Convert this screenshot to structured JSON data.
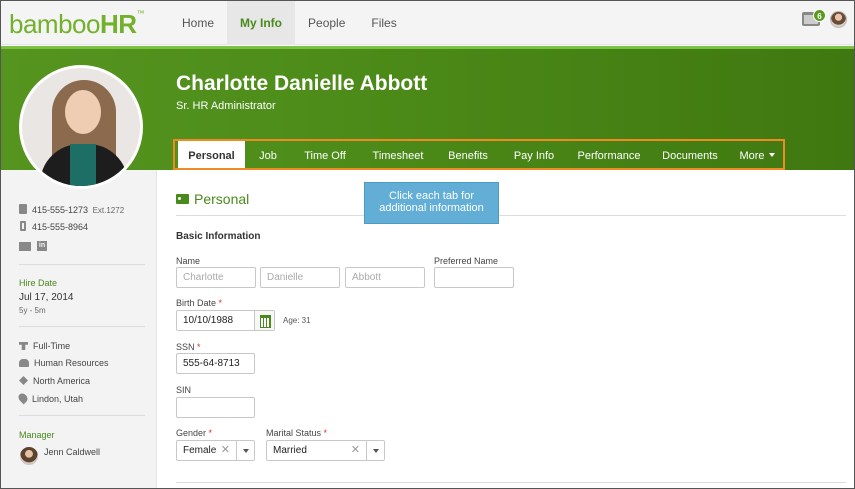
{
  "app": {
    "logo_main": "bamboo",
    "logo_bold": "HR",
    "logo_tm": "™"
  },
  "nav": {
    "items": [
      {
        "label": "Home"
      },
      {
        "label": "My Info"
      },
      {
        "label": "People"
      },
      {
        "label": "Files"
      }
    ],
    "active": "My Info",
    "inbox_count": "6"
  },
  "employee": {
    "name": "Charlotte Danielle Abbott",
    "title": "Sr. HR Administrator"
  },
  "tabs": {
    "items": [
      {
        "label": "Personal"
      },
      {
        "label": "Job"
      },
      {
        "label": "Time Off"
      },
      {
        "label": "Timesheet"
      },
      {
        "label": "Benefits"
      },
      {
        "label": "Pay Info"
      },
      {
        "label": "Performance"
      },
      {
        "label": "Documents"
      },
      {
        "label": "More"
      }
    ],
    "active": "Personal"
  },
  "sidebar": {
    "work_phone": "415-555-1273",
    "work_ext": "Ext.1272",
    "mobile_phone": "415-555-8964",
    "hire_date_label": "Hire Date",
    "hire_date": "Jul 17, 2014",
    "tenure": "5y - 5m",
    "employment_type": "Full-Time",
    "department": "Human Resources",
    "region": "North America",
    "location": "Lindon, Utah",
    "manager_label": "Manager",
    "manager_name": "Jenn Caldwell"
  },
  "section": {
    "title": "Personal",
    "subhead": "Basic Information",
    "tooltip_line1": "Click each tab for",
    "tooltip_line2": "additional information"
  },
  "form": {
    "name_label": "Name",
    "first_name_placeholder": "Charlotte",
    "middle_name_placeholder": "Danielle",
    "last_name_placeholder": "Abbott",
    "preferred_name_label": "Preferred Name",
    "preferred_name_value": "",
    "birth_date_label": "Birth Date",
    "birth_date_value": "10/10/1988",
    "age": "Age: 31",
    "ssn_label": "SSN",
    "ssn_value": "555-64-8713",
    "sin_label": "SIN",
    "sin_value": "",
    "gender_label": "Gender",
    "gender_value": "Female",
    "marital_label": "Marital Status",
    "marital_value": "Married",
    "required_mark": "*",
    "clear_mark": "✕"
  },
  "colors": {
    "brand_green": "#73b12c",
    "banner_green": "#4e8d1a",
    "tab_highlight": "#f08a24",
    "tooltip_blue": "#62aed6"
  }
}
